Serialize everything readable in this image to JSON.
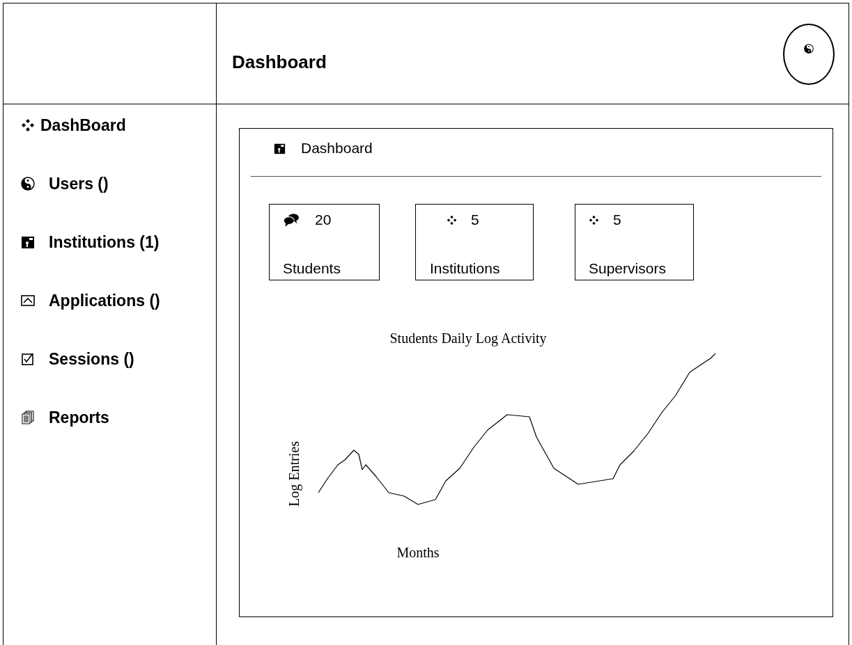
{
  "header": {
    "title": "Dashboard"
  },
  "sidebar": {
    "items": [
      {
        "label": "DashBoard"
      },
      {
        "label": "Users ()"
      },
      {
        "label": "Institutions (1)"
      },
      {
        "label": "Applications ()"
      },
      {
        "label": "Sessions ()"
      },
      {
        "label": "Reports"
      }
    ]
  },
  "panel": {
    "title": "Dashboard",
    "cards": [
      {
        "value": "20",
        "label": "Students"
      },
      {
        "value": "5",
        "label": "Institutions"
      },
      {
        "value": "5",
        "label": "Supervisors"
      }
    ],
    "chart": {
      "title": "Students Daily Log Activity",
      "ylabel": "Log Entries",
      "xlabel": "Months"
    }
  }
}
